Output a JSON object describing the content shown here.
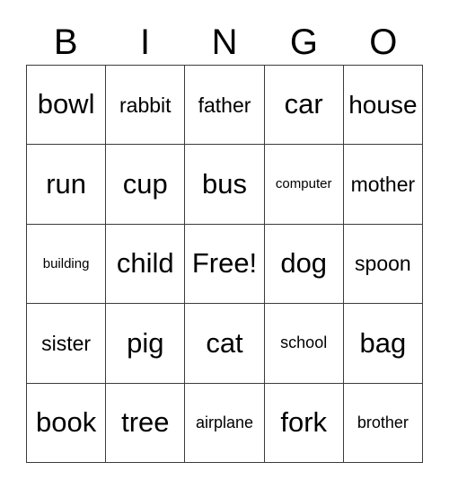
{
  "card": {
    "title": "BINGO",
    "headers": [
      "B",
      "I",
      "N",
      "G",
      "O"
    ],
    "free_space_label": "Free!",
    "colors": {
      "background": "#ffffff",
      "text": "#000000",
      "grid_line": "#3b3b3b"
    },
    "grid": {
      "columns": 5,
      "rows": 5,
      "cells": [
        [
          {
            "label": "bowl",
            "size": "xl"
          },
          {
            "label": "rabbit",
            "size": "md"
          },
          {
            "label": "father",
            "size": "md"
          },
          {
            "label": "car",
            "size": "xl"
          },
          {
            "label": "house",
            "size": "lg"
          }
        ],
        [
          {
            "label": "run",
            "size": "xl"
          },
          {
            "label": "cup",
            "size": "xl"
          },
          {
            "label": "bus",
            "size": "xl"
          },
          {
            "label": "computer",
            "size": "xs"
          },
          {
            "label": "mother",
            "size": "md"
          }
        ],
        [
          {
            "label": "building",
            "size": "xs"
          },
          {
            "label": "child",
            "size": "xl"
          },
          {
            "label": "Free!",
            "size": "xl"
          },
          {
            "label": "dog",
            "size": "xl"
          },
          {
            "label": "spoon",
            "size": "md"
          }
        ],
        [
          {
            "label": "sister",
            "size": "md"
          },
          {
            "label": "pig",
            "size": "xl"
          },
          {
            "label": "cat",
            "size": "xl"
          },
          {
            "label": "school",
            "size": "sm"
          },
          {
            "label": "bag",
            "size": "xl"
          }
        ],
        [
          {
            "label": "book",
            "size": "xl"
          },
          {
            "label": "tree",
            "size": "xl"
          },
          {
            "label": "airplane",
            "size": "sm"
          },
          {
            "label": "fork",
            "size": "xl"
          },
          {
            "label": "brother",
            "size": "sm"
          }
        ]
      ]
    }
  }
}
